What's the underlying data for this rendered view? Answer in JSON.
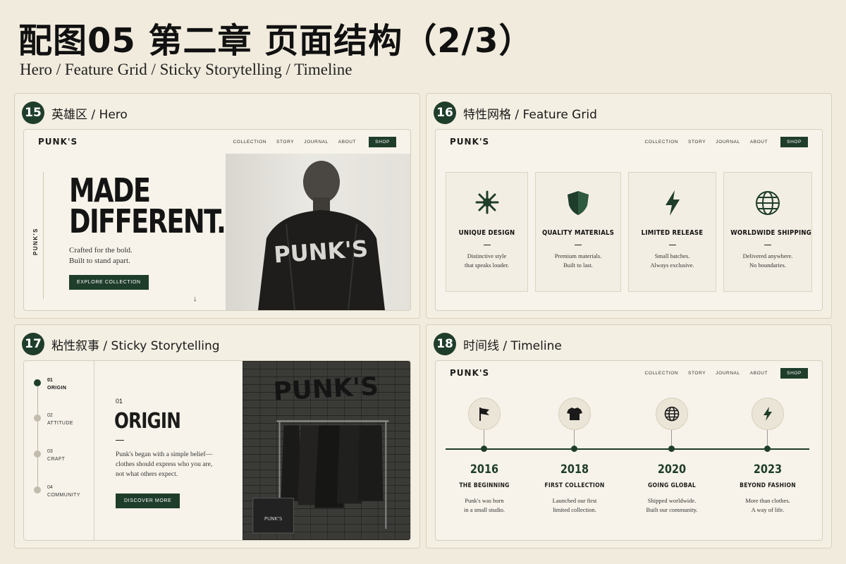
{
  "header": {
    "title": "配图05 第二章 页面结构（2/3）",
    "subtitle": "Hero / Feature Grid / Sticky Storytelling / Timeline"
  },
  "nav": {
    "logo": "PUNK'S",
    "links": [
      "COLLECTION",
      "STORY",
      "JOURNAL",
      "ABOUT"
    ],
    "shop": "SHOP"
  },
  "panels": [
    {
      "number": "15",
      "label": "英雄区 / Hero",
      "vertical_text": "PUNK'S",
      "headline": [
        "MADE",
        "DIFFERENT."
      ],
      "subline": [
        "Crafted for the bold.",
        "Built to stand apart."
      ],
      "cta": "EXPLORE COLLECTION",
      "scroll_glyph": "↓"
    },
    {
      "number": "16",
      "label": "特性网格 / Feature Grid",
      "features": [
        {
          "icon": "star-burst-icon",
          "title": "UNIQUE DESIGN",
          "desc": [
            "Distinctive style",
            "that speaks louder."
          ]
        },
        {
          "icon": "shield-icon",
          "title": "QUALITY MATERIALS",
          "desc": [
            "Premium materials.",
            "Built to last."
          ]
        },
        {
          "icon": "lightning-icon",
          "title": "LIMITED RELEASE",
          "desc": [
            "Small batches.",
            "Always exclusive."
          ]
        },
        {
          "icon": "globe-icon",
          "title": "WORLDWIDE SHIPPING",
          "desc": [
            "Delivered anywhere.",
            "No boundaries."
          ]
        }
      ]
    },
    {
      "number": "17",
      "label": "粘性叙事 / Sticky Storytelling",
      "steps": [
        {
          "num": "01",
          "label": "ORIGIN",
          "active": true
        },
        {
          "num": "02",
          "label": "ATTITUDE",
          "active": false
        },
        {
          "num": "03",
          "label": "CRAFT",
          "active": false
        },
        {
          "num": "04",
          "label": "COMMUNITY",
          "active": false
        }
      ],
      "content_num": "01",
      "content_title": "ORIGIN",
      "content_body": [
        "Punk's began with a simple belief—",
        "clothes should express who you are,",
        "not what others expect."
      ],
      "cta": "DISCOVER MORE"
    },
    {
      "number": "18",
      "label": "时间线 / Timeline",
      "events": [
        {
          "icon": "flag-icon",
          "year": "2016",
          "title": "THE BEGINNING",
          "desc": [
            "Punk's was born",
            "in a small studio."
          ]
        },
        {
          "icon": "tshirt-icon",
          "year": "2018",
          "title": "FIRST COLLECTION",
          "desc": [
            "Launched our first",
            "limited collection."
          ]
        },
        {
          "icon": "globe-icon",
          "year": "2020",
          "title": "GOING GLOBAL",
          "desc": [
            "Shipped worldwide.",
            "Built our community."
          ]
        },
        {
          "icon": "lightning-icon",
          "year": "2023",
          "title": "BEYOND FASHION",
          "desc": [
            "More than clothes.",
            "A way of life."
          ]
        }
      ]
    }
  ],
  "colors": {
    "accent": "#1f3d2b",
    "background": "#f1ebdd"
  }
}
